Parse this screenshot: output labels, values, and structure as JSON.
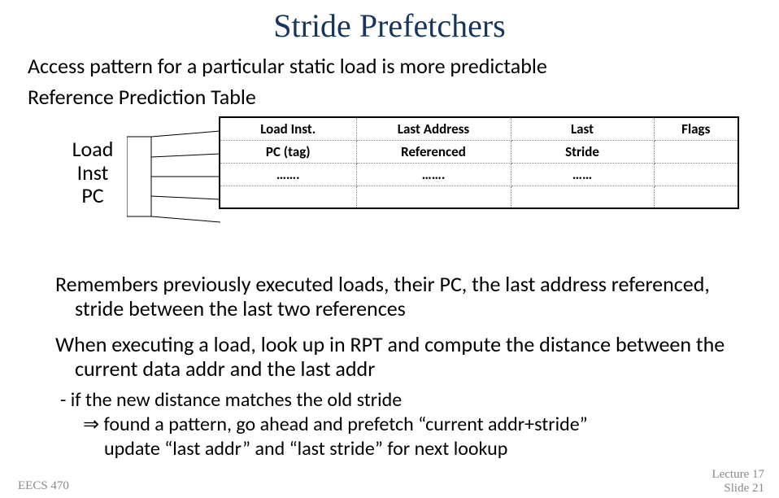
{
  "title": "Stride Prefetchers",
  "subtitle": "Access pattern for a particular static load is more predictable",
  "rpt_label": "Reference Prediction Table",
  "load_pc": {
    "l1": "Load",
    "l2": "Inst",
    "l3": "PC"
  },
  "table": {
    "r0": {
      "c1": "Load Inst.",
      "c2": "Last Address",
      "c3": "Last",
      "c4": "Flags"
    },
    "r1": {
      "c1": "PC (tag)",
      "c2": "Referenced",
      "c3": "Stride",
      "c4": ""
    },
    "r2": {
      "c1": "…….",
      "c2": "…….",
      "c3": "……",
      "c4": ""
    },
    "r3": {
      "c1": "",
      "c2": "",
      "c3": "",
      "c4": ""
    }
  },
  "para1": "Remembers previously executed loads, their PC, the last address referenced, stride between the last two references",
  "para2": "When executing a load, look up in RPT and compute the distance between the current data addr and the last addr",
  "bullet1": "- if the new distance matches the old stride",
  "bullet2a": "⇒",
  "bullet2b": " found a pattern, go ahead and prefetch “current addr+stride”",
  "bullet3": "update “last addr” and “last stride” for next lookup",
  "footer": {
    "left": "EECS 470",
    "right1": "Lecture 17",
    "right2": "Slide 21"
  }
}
